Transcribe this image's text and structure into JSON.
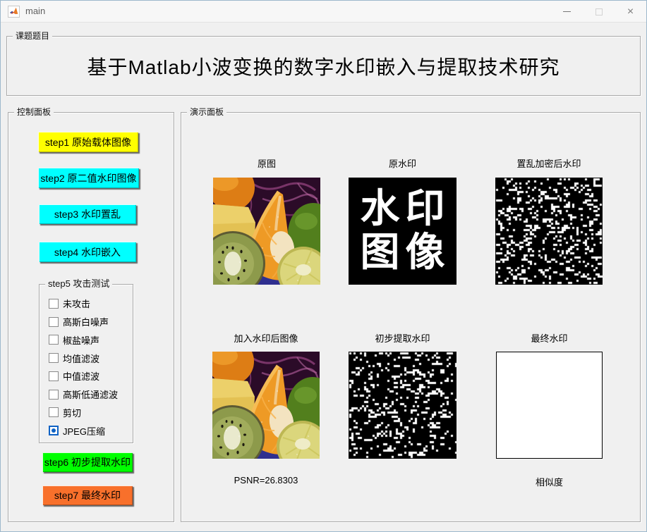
{
  "window": {
    "title": "main",
    "controls": {
      "minimize_icon": "minimize-dash",
      "maximize_icon": "maximize-square",
      "close_icon": "close-x",
      "close_glyph": "×"
    }
  },
  "colors": {
    "radio_accent": "#0f62c4",
    "step1": "#ffff00",
    "step2": "#00ffff",
    "step3": "#00ffff",
    "step4": "#00ffff",
    "step6": "#00ff00",
    "step7": "#f8702b",
    "background": "#f0f0f0"
  },
  "title_panel": {
    "label": "课题题目",
    "title": "基于Matlab小波变换的数字水印嵌入与提取技术研究"
  },
  "control_panel": {
    "label": "控制面板",
    "buttons": [
      {
        "id": "step1",
        "label": "step1 原始载体图像"
      },
      {
        "id": "step2",
        "label": "step2 原二值水印图像"
      },
      {
        "id": "step3",
        "label": "step3 水印置乱"
      },
      {
        "id": "step4",
        "label": "step4 水印嵌入"
      }
    ],
    "attack_group": {
      "label": "step5 攻击测试",
      "options": [
        {
          "label": "未攻击",
          "selected": false
        },
        {
          "label": "高斯白噪声",
          "selected": false
        },
        {
          "label": "椒盐噪声",
          "selected": false
        },
        {
          "label": "均值滤波",
          "selected": false
        },
        {
          "label": "中值滤波",
          "selected": false
        },
        {
          "label": "高斯低通滤波",
          "selected": false
        },
        {
          "label": "剪切",
          "selected": false
        },
        {
          "label": "JPEG压缩",
          "selected": true
        }
      ]
    },
    "bottom_buttons": [
      {
        "id": "step6",
        "label": "step6 初步提取水印"
      },
      {
        "id": "step7",
        "label": "step7 最终水印"
      }
    ]
  },
  "demo_panel": {
    "label": "演示面板",
    "cells": [
      {
        "caption": "原图",
        "type": "photo-fruits"
      },
      {
        "caption": "原水印",
        "type": "binary-watermark",
        "text_lines": [
          "水印",
          "图像"
        ]
      },
      {
        "caption": "置乱加密后水印",
        "type": "noise",
        "seed": 20240301,
        "density": 0.17
      },
      {
        "caption": "加入水印后图像",
        "type": "photo-fruits"
      },
      {
        "caption": "初步提取水印",
        "type": "noise",
        "seed": 987654,
        "density": 0.15
      },
      {
        "caption": "最终水印",
        "type": "blank-white"
      }
    ],
    "psnr_text": "PSNR=26.8303",
    "similarity_label": "相似度"
  }
}
